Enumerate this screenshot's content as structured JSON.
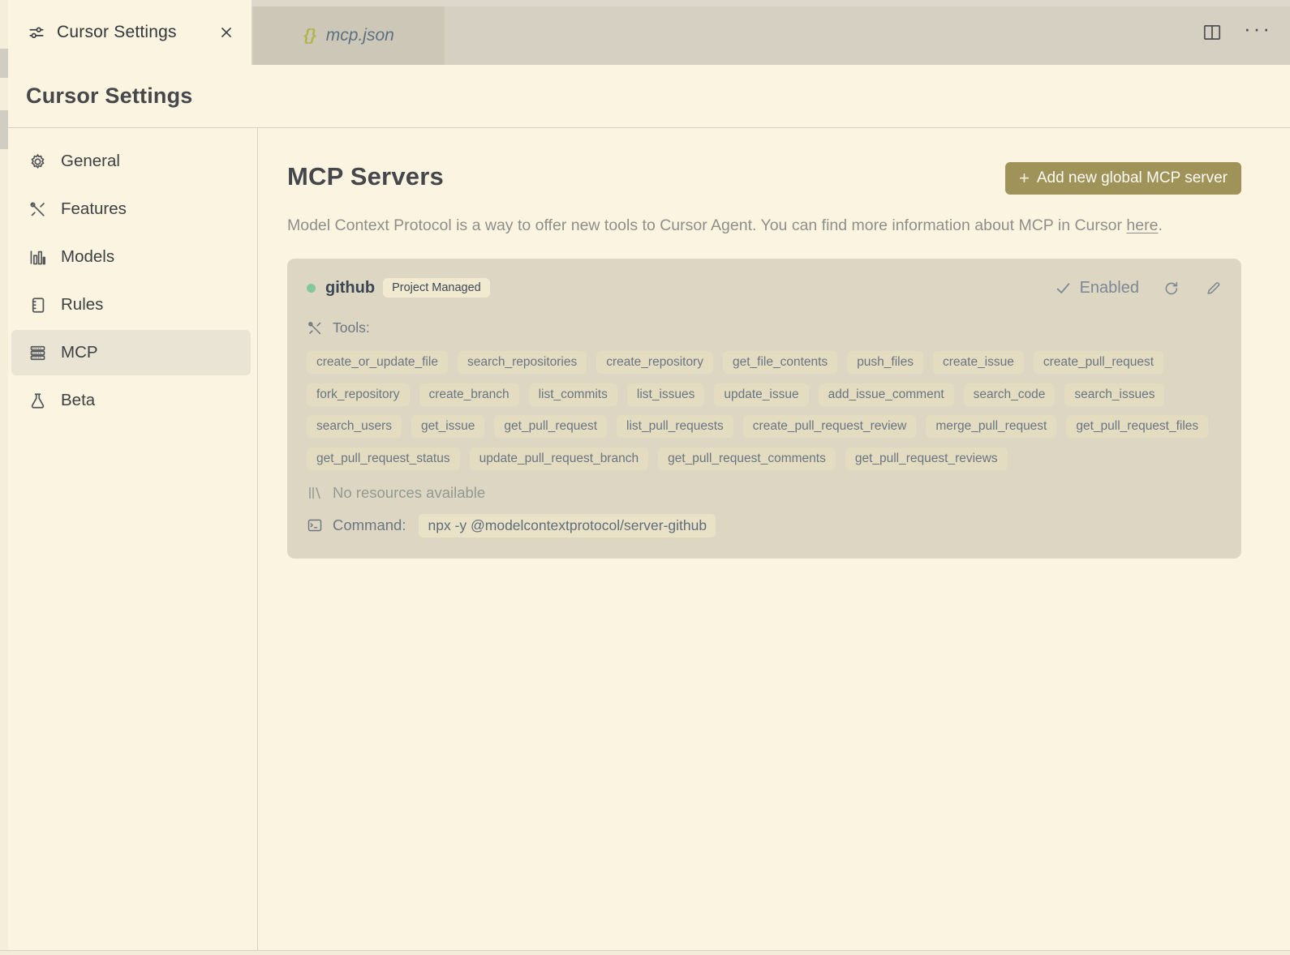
{
  "tabbar": {
    "settings_tab": {
      "label": "Cursor Settings"
    },
    "file_tab": {
      "label": "mcp.json",
      "icon_glyph": "{}"
    },
    "more_glyph": "···"
  },
  "page": {
    "title": "Cursor Settings"
  },
  "sidebar": {
    "items": [
      {
        "label": "General",
        "icon": "gear-icon"
      },
      {
        "label": "Features",
        "icon": "tools-icon"
      },
      {
        "label": "Models",
        "icon": "bar-chart-icon"
      },
      {
        "label": "Rules",
        "icon": "notebook-icon"
      },
      {
        "label": "MCP",
        "icon": "server-stack-icon",
        "selected": true
      },
      {
        "label": "Beta",
        "icon": "flask-icon"
      }
    ]
  },
  "main": {
    "heading": "MCP Servers",
    "add_button": {
      "plus": "+",
      "label": "Add new global MCP server"
    },
    "description": {
      "before": "Model Context Protocol is a way to offer new tools to Cursor Agent. You can find more information about MCP in Cursor ",
      "link": "here",
      "after": "."
    }
  },
  "server_card": {
    "name": "github",
    "badge": "Project Managed",
    "status_label": "Enabled",
    "tools_label": "Tools:",
    "tools": [
      "create_or_update_file",
      "search_repositories",
      "create_repository",
      "get_file_contents",
      "push_files",
      "create_issue",
      "create_pull_request",
      "fork_repository",
      "create_branch",
      "list_commits",
      "list_issues",
      "update_issue",
      "add_issue_comment",
      "search_code",
      "search_issues",
      "search_users",
      "get_issue",
      "get_pull_request",
      "list_pull_requests",
      "create_pull_request_review",
      "merge_pull_request",
      "get_pull_request_files",
      "get_pull_request_status",
      "update_pull_request_branch",
      "get_pull_request_comments",
      "get_pull_request_reviews"
    ],
    "resources_text": "No resources available",
    "command_label": "Command:",
    "command_value": "npx -y @modelcontextprotocol/server-github"
  },
  "colors": {
    "accent_olive": "#a0935a",
    "card_bg": "#dcd6c3",
    "chip_bg": "#e3dcc1",
    "editor_bg": "#fbf4e1",
    "tabbar_bg": "#d6d0c2",
    "status_dot_green": "#84c79b"
  }
}
